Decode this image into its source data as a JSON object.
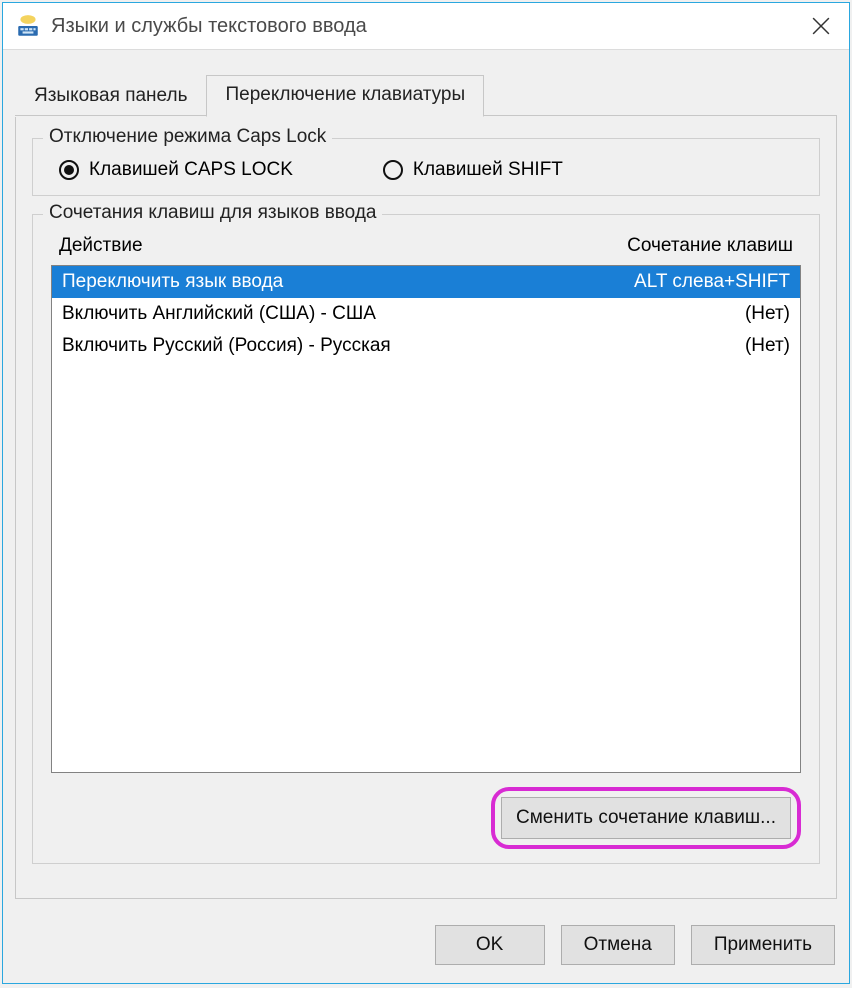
{
  "window": {
    "title": "Языки и службы текстового ввода"
  },
  "tabs": [
    {
      "label": "Языковая панель"
    },
    {
      "label": "Переключение клавиатуры"
    }
  ],
  "caps_group": {
    "title": "Отключение режима Caps Lock",
    "options": [
      {
        "label": "Клавишей CAPS LOCK",
        "checked": true
      },
      {
        "label": "Клавишей SHIFT",
        "checked": false
      }
    ]
  },
  "hotkeys_group": {
    "title": "Сочетания клавиш для языков ввода",
    "headers": {
      "action": "Действие",
      "combo": "Сочетание клавиш"
    },
    "rows": [
      {
        "action": "Переключить язык ввода",
        "combo": "ALT слева+SHIFT",
        "selected": true
      },
      {
        "action": "Включить Английский (США) - США",
        "combo": "(Нет)",
        "selected": false
      },
      {
        "action": "Включить Русский (Россия) - Русская",
        "combo": "(Нет)",
        "selected": false
      }
    ],
    "change_button": "Сменить сочетание клавиш..."
  },
  "buttons": {
    "ok": "OK",
    "cancel": "Отмена",
    "apply": "Применить"
  }
}
